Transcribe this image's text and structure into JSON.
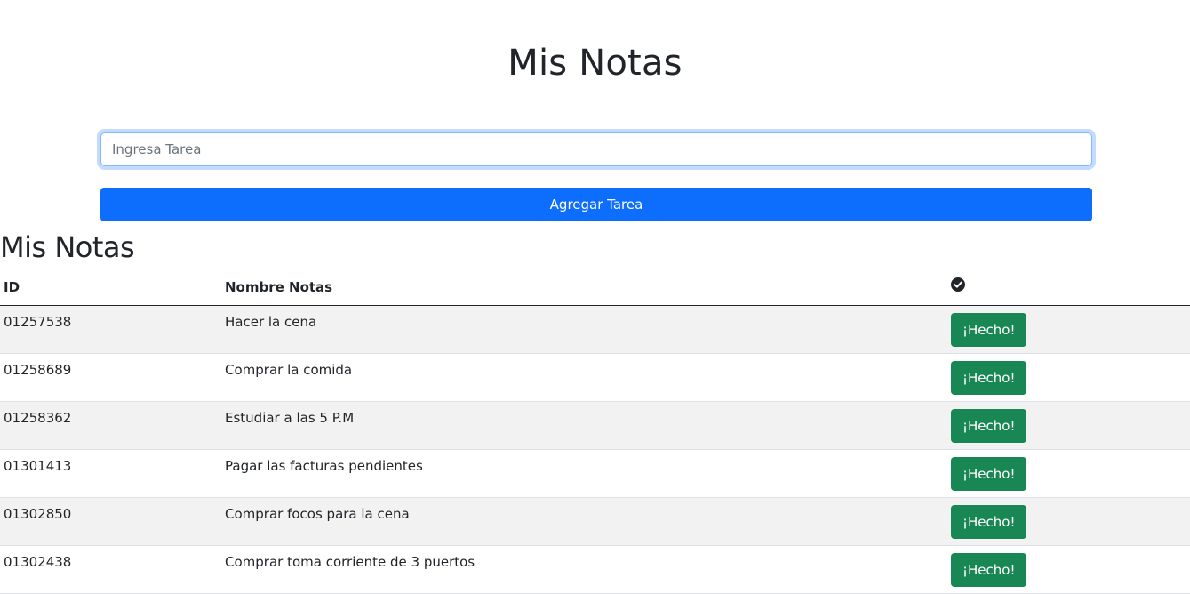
{
  "header": {
    "title": "Mis Notas"
  },
  "form": {
    "input_placeholder": "Ingresa Tarea",
    "input_value": "",
    "add_button_label": "Agregar Tarea"
  },
  "section": {
    "title": "Mis Notas"
  },
  "table": {
    "columns": {
      "id": "ID",
      "name": "Nombre Notas",
      "action_icon": "check-circle-icon"
    },
    "done_label": "¡Hecho!",
    "rows": [
      {
        "id": "01257538",
        "name": "Hacer la cena"
      },
      {
        "id": "01258689",
        "name": "Comprar la comida"
      },
      {
        "id": "01258362",
        "name": "Estudiar a las 5 P.M"
      },
      {
        "id": "01301413",
        "name": "Pagar las facturas pendientes"
      },
      {
        "id": "01302850",
        "name": "Comprar focos para la cena"
      },
      {
        "id": "01302438",
        "name": "Comprar toma corriente de 3 puertos"
      }
    ]
  },
  "colors": {
    "primary": "#0d6efd",
    "success": "#198754",
    "stripe": "#f2f2f2",
    "text": "#212529"
  }
}
